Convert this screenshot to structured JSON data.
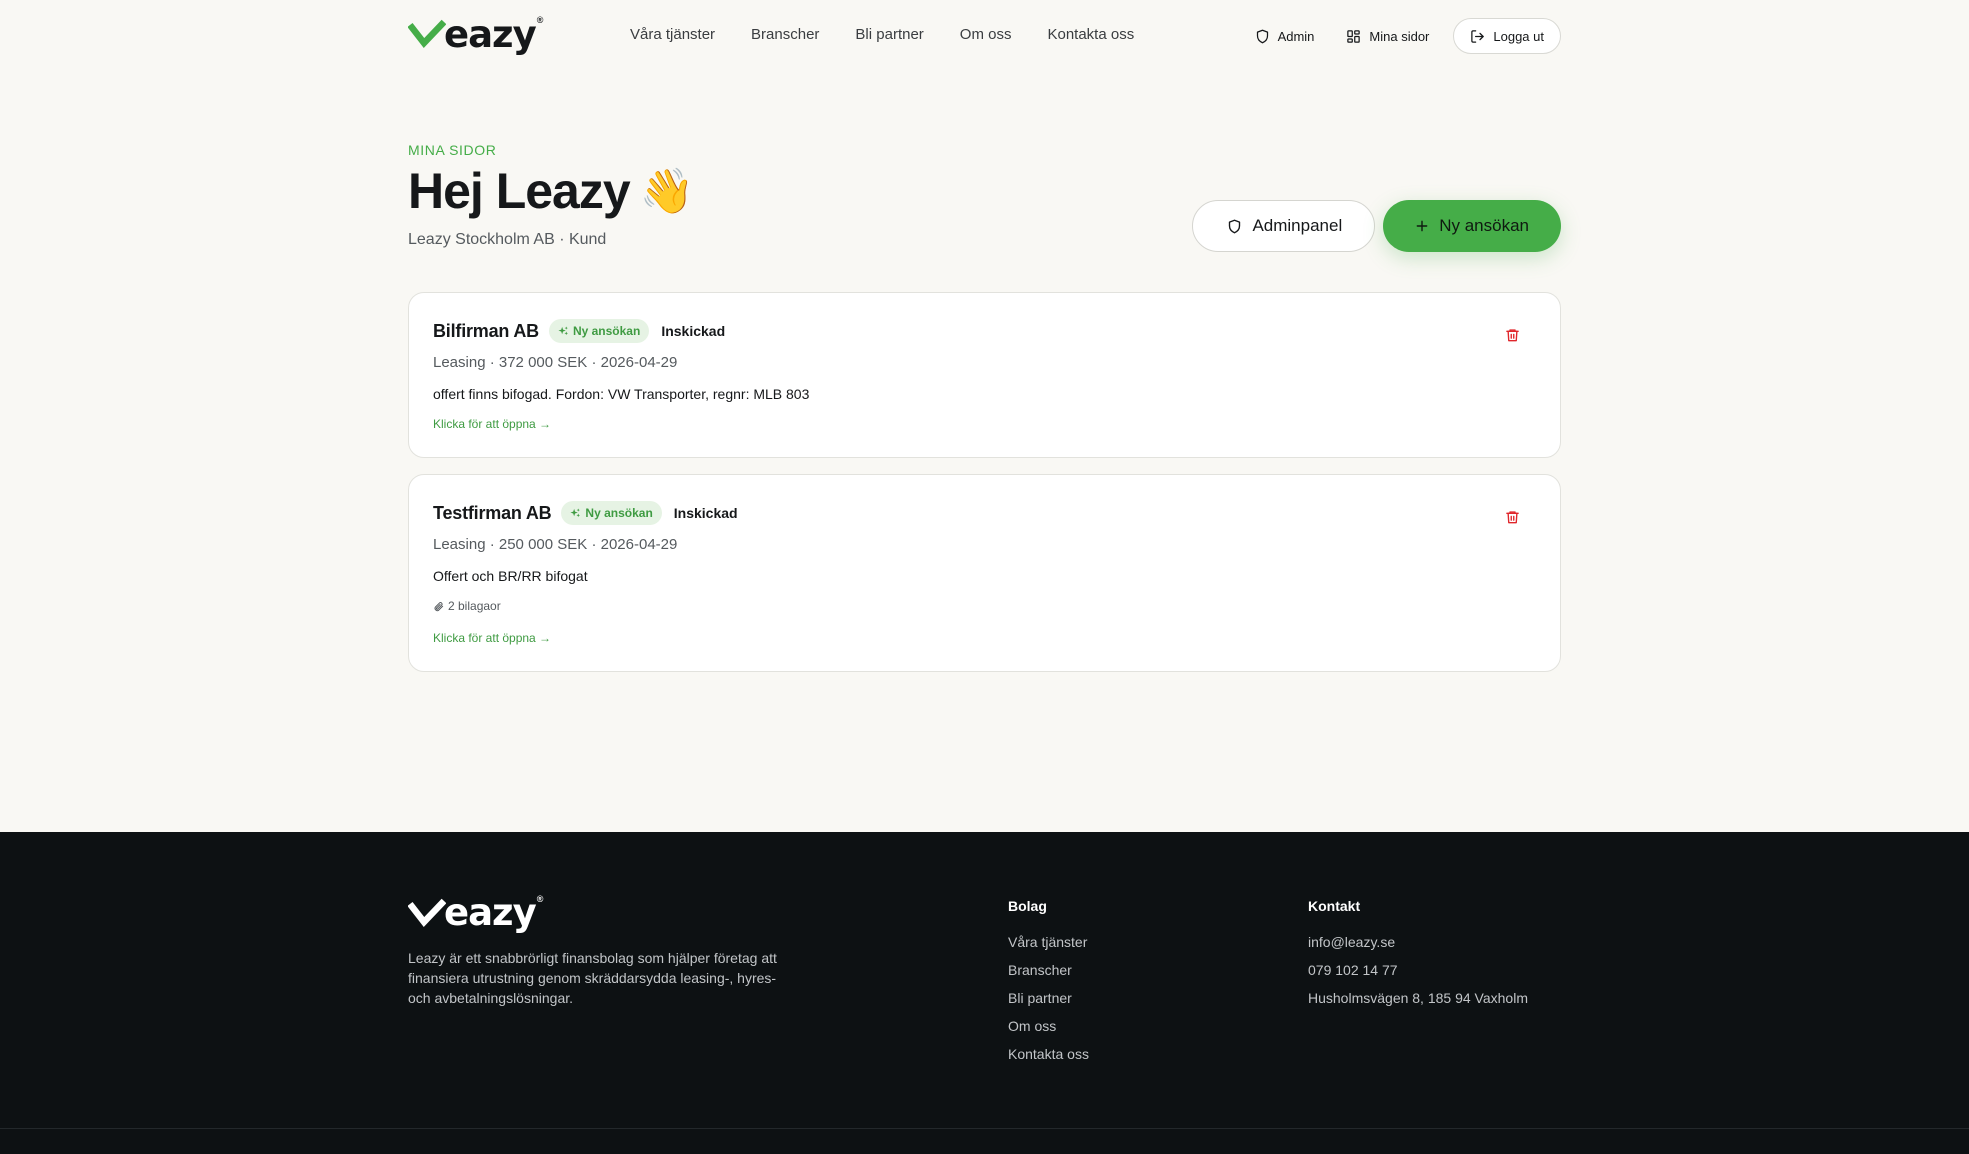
{
  "brand": {
    "name": "eazy",
    "registered": "®",
    "accent": "#45ad48"
  },
  "nav": {
    "items": [
      {
        "label": "Våra tjänster"
      },
      {
        "label": "Branscher"
      },
      {
        "label": "Bli partner"
      },
      {
        "label": "Om oss"
      },
      {
        "label": "Kontakta oss"
      }
    ]
  },
  "header_actions": {
    "admin": {
      "label": "Admin",
      "icon": "shield-icon"
    },
    "mina_sidor": {
      "label": "Mina sidor",
      "icon": "grid-icon"
    },
    "logout": {
      "label": "Logga ut",
      "icon": "logout-icon"
    }
  },
  "hero": {
    "eyebrow": "MINA SIDOR",
    "title": "Hej Leazy",
    "emoji": "👋",
    "subtitle": "Leazy Stockholm AB · Kund",
    "admin_button": "Adminpanel",
    "new_button": "Ny ansökan"
  },
  "applications": [
    {
      "company": "Bilfirman AB",
      "badge": "Ny ansökan",
      "status": "Inskickad",
      "meta": "Leasing · 372 000 SEK · 2026-04-29",
      "description": "offert finns bifogad. Fordon: VW Transporter, regnr: MLB 803",
      "open_link": "Klicka för att öppna →"
    },
    {
      "company": "Testfirman AB",
      "badge": "Ny ansökan",
      "status": "Inskickad",
      "meta": "Leasing · 250 000 SEK · 2026-04-29",
      "description": "Offert och BR/RR bifogat",
      "attachments": "2 bilagaor",
      "open_link": "Klicka för att öppna →"
    }
  ],
  "footer": {
    "description": "Leazy är ett snabbrörligt finansbolag som hjälper företag att finansiera utrustning genom skräddarsydda leasing-, hyres- och avbetalningslösningar.",
    "company": {
      "heading": "Bolag",
      "links": [
        "Våra tjänster",
        "Branscher",
        "Bli partner",
        "Om oss",
        "Kontakta oss"
      ]
    },
    "contact": {
      "heading": "Kontakt",
      "email": "info@leazy.se",
      "phone": "079 102 14 77",
      "address": "Husholmsvägen 8, 185 94 Vaxholm"
    }
  }
}
